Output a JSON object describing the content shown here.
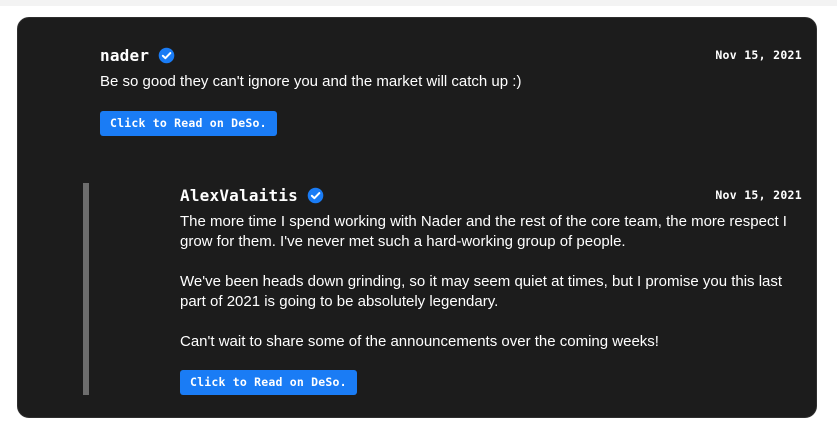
{
  "post": {
    "username": "nader",
    "verified_icon": "verified-badge-icon",
    "date": "Nov 15, 2021",
    "body": "Be so good they can't ignore you and the market will catch up :)",
    "read_button": "Click to Read on DeSo."
  },
  "reply": {
    "username": "AlexValaitis",
    "verified_icon": "verified-badge-icon",
    "date": "Nov 15, 2021",
    "paragraphs": [
      "The more time I spend working with Nader and the rest of the core team, the more respect I grow for them. I've never met such a hard-working group of people.",
      "We've been heads down grinding, so it may seem quiet at times, but I promise you this last part of 2021 is going to be absolutely legendary.",
      "Can't wait to share some of the announcements over the coming weeks!"
    ],
    "read_button": "Click to Read on DeSo."
  },
  "colors": {
    "card_background": "#1c1c1c",
    "accent": "#1a7cf5",
    "text": "#ffffff",
    "reply_bar": "#6d6d6d"
  }
}
